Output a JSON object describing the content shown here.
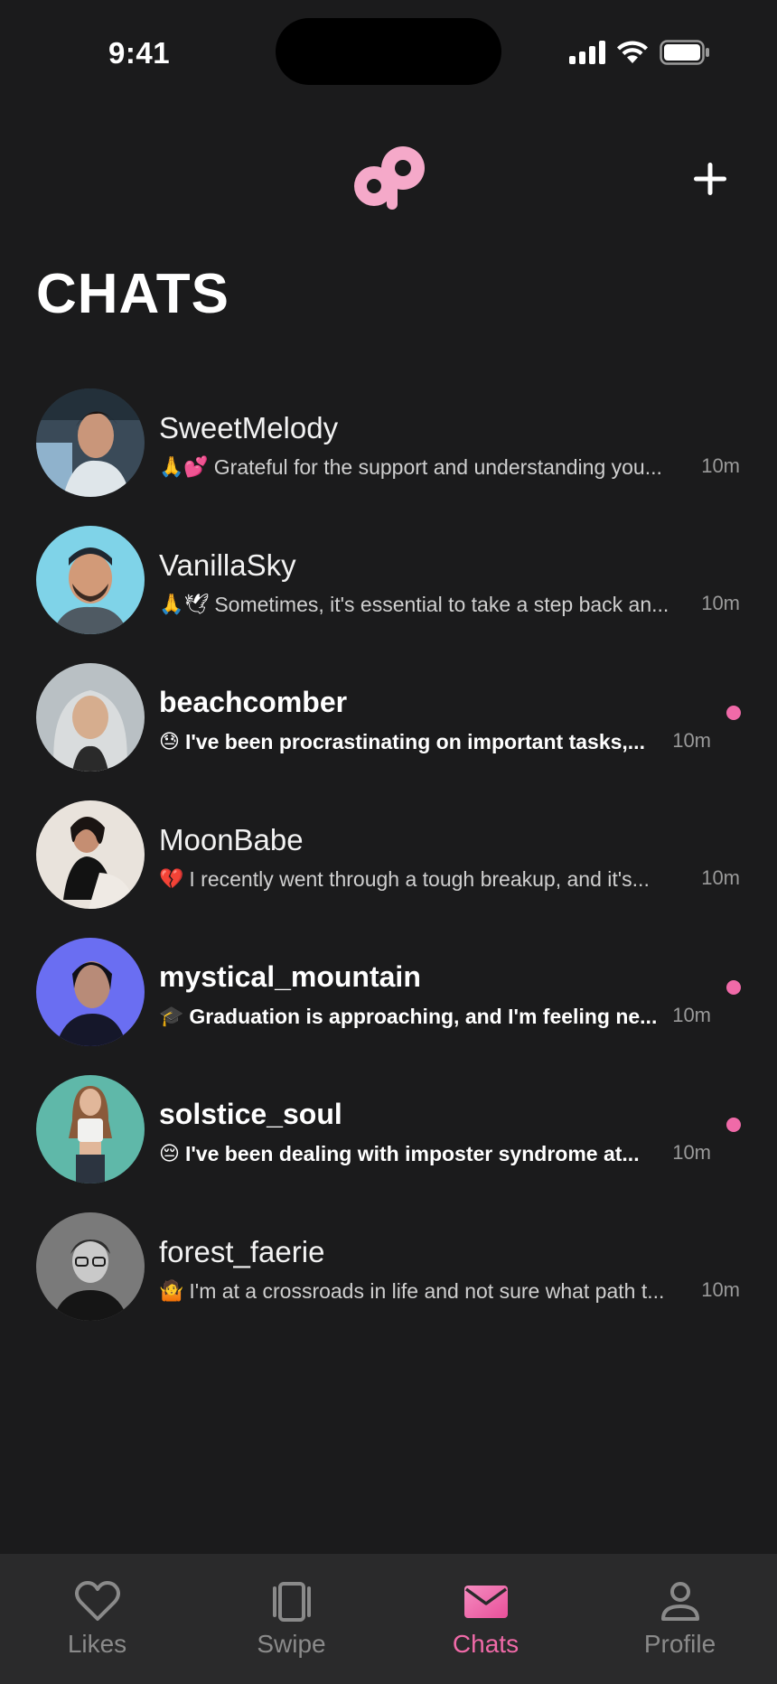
{
  "status_bar": {
    "time": "9:41"
  },
  "header": {
    "logo_icon": "app-logo-icon",
    "add_icon": "plus-icon"
  },
  "page_title": "CHATS",
  "accent_color": "#f06aa8",
  "chats": [
    {
      "name": "SweetMelody",
      "emoji": "🙏💕",
      "preview": "Grateful for the support and understanding you...",
      "time": "10m",
      "unread": false
    },
    {
      "name": "VanillaSky",
      "emoji": "🙏🕊",
      "preview": "Sometimes, it's essential to take a step back an...",
      "time": "10m",
      "unread": false
    },
    {
      "name": "beachcomber",
      "emoji": "😓",
      "preview": "I've been procrastinating on important tasks,...",
      "time": "10m",
      "unread": true
    },
    {
      "name": "MoonBabe",
      "emoji": "💔",
      "preview": "I recently went through a tough breakup, and it's...",
      "time": "10m",
      "unread": false
    },
    {
      "name": "mystical_mountain",
      "emoji": "🎓",
      "preview": "Graduation is approaching, and I'm feeling ne...",
      "time": "10m",
      "unread": true
    },
    {
      "name": "solstice_soul",
      "emoji": "😔",
      "preview": "I've been dealing with imposter syndrome at...",
      "time": "10m",
      "unread": true
    },
    {
      "name": "forest_faerie",
      "emoji": "🤷",
      "preview": "I'm at a crossroads in life and not sure what path t...",
      "time": "10m",
      "unread": false
    }
  ],
  "nav": [
    {
      "label": "Likes",
      "icon": "heart-icon",
      "active": false
    },
    {
      "label": "Swipe",
      "icon": "cards-icon",
      "active": false
    },
    {
      "label": "Chats",
      "icon": "mail-icon",
      "active": true
    },
    {
      "label": "Profile",
      "icon": "person-icon",
      "active": false
    }
  ]
}
